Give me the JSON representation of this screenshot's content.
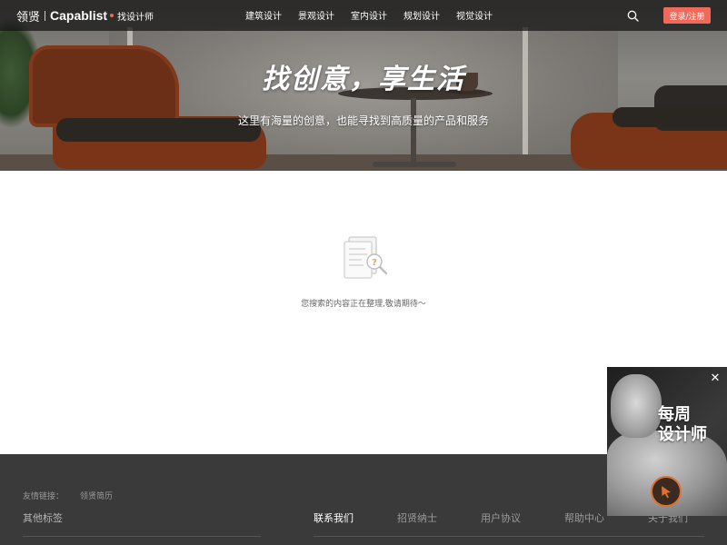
{
  "header": {
    "logo_cn": "领贤",
    "logo_en": "Capablist",
    "find_designer": "找设计师",
    "nav": [
      "建筑设计",
      "景观设计",
      "室内设计",
      "规划设计",
      "视觉设计"
    ],
    "login_label": "登录/注册",
    "search_icon": "search-icon"
  },
  "hero": {
    "slogan": "找创意，享生活",
    "subtitle": "这里有海量的创意，也能寻找到高质量的产品和服务"
  },
  "empty_state": {
    "icon": "document-search-icon",
    "message": "您搜索的内容正在整理,敬请期待～"
  },
  "footer": {
    "friend_links_label": "友情链接：",
    "friend_links": [
      "领贤简历"
    ],
    "other_tags": "其他标签",
    "links": [
      "联系我们",
      "招贤纳士",
      "用户协议",
      "帮助中心",
      "关于我们"
    ]
  },
  "promo": {
    "title_line1": "每周",
    "title_line2": "设计师",
    "close_icon": "close-icon",
    "cursor_icon": "cursor-click-icon"
  },
  "colors": {
    "accent": "#ef6a5a",
    "footer_bg": "#3a3a3a",
    "nav_bg": "#141414"
  }
}
